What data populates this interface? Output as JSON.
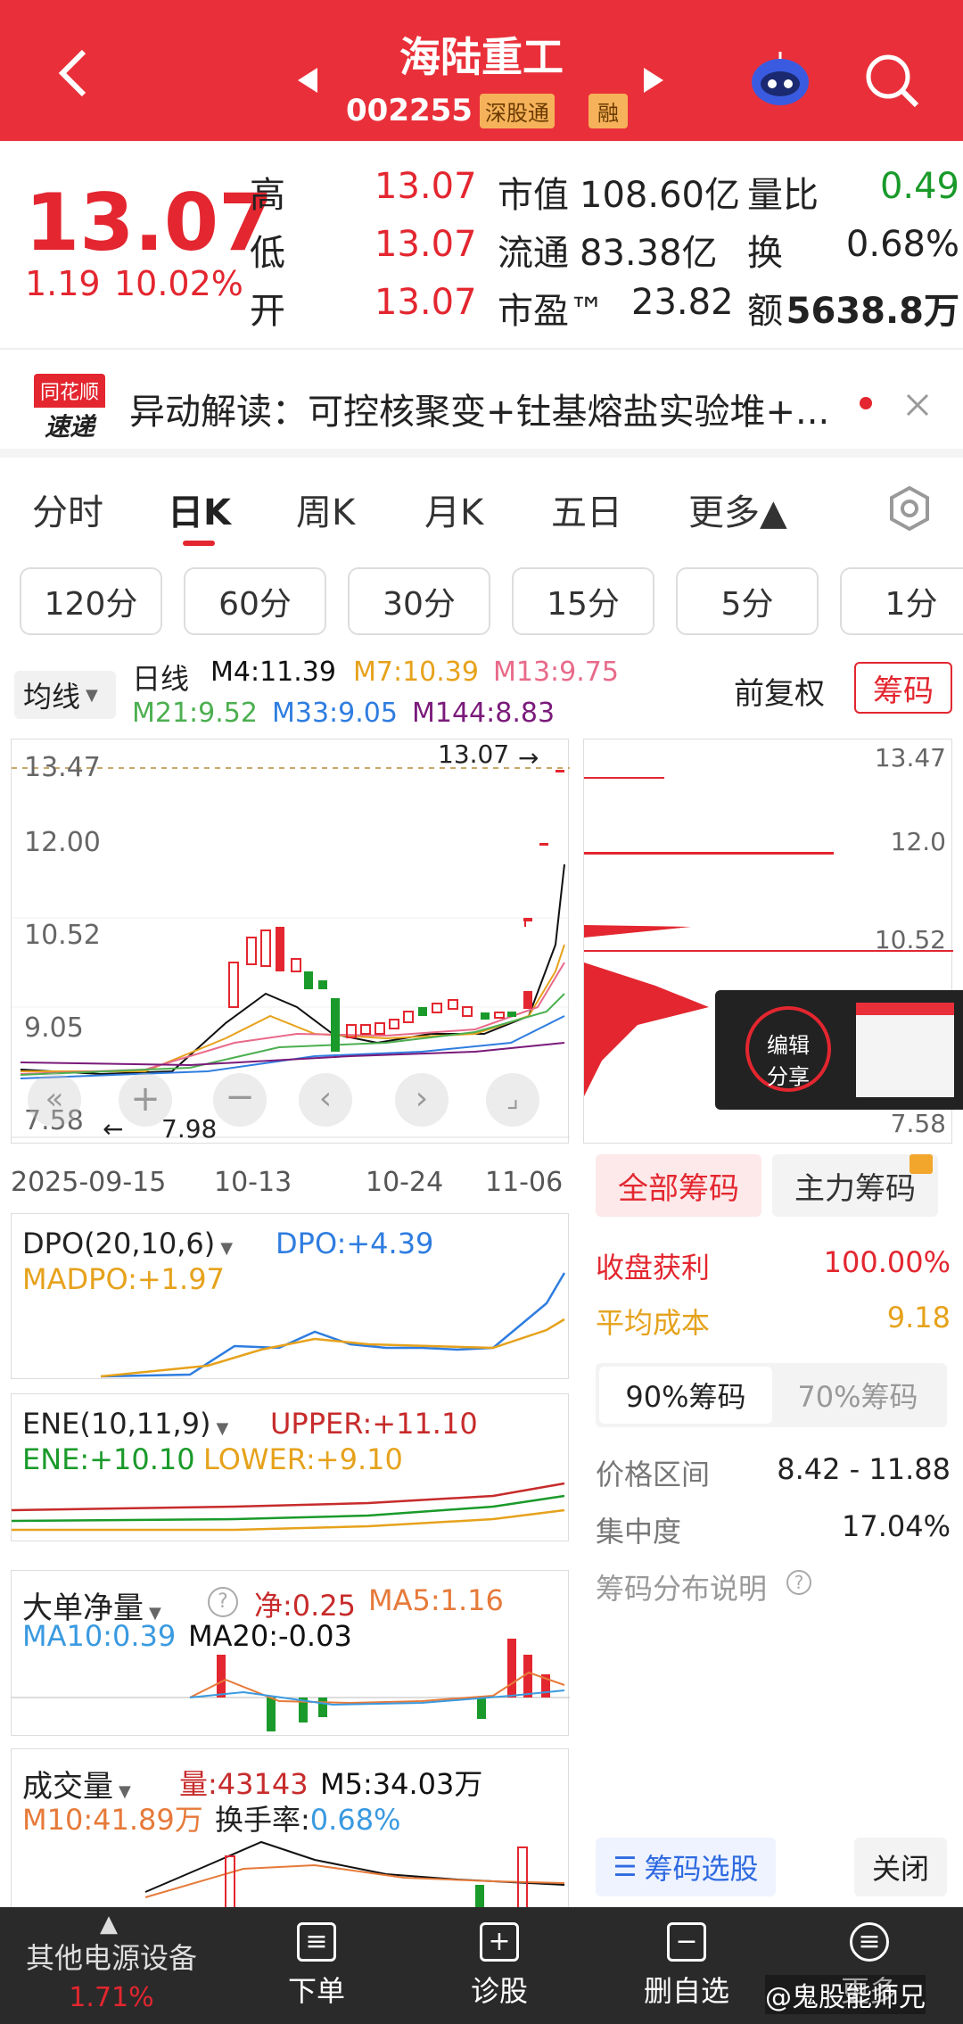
{
  "header": {
    "title": "海陆重工",
    "code": "002255",
    "badge1": "深股通",
    "badge2": "融"
  },
  "quote": {
    "price": "13.07",
    "change": "1.19",
    "pct": "10.02%",
    "high_label": "高",
    "high": "13.07",
    "low_label": "低",
    "low": "13.07",
    "open_label": "开",
    "open": "13.07",
    "mcap_label": "市值",
    "mcap": "108.60亿",
    "float_label": "流通",
    "float": "83.38亿",
    "pe_label": "市盈™",
    "pe": "23.82",
    "vr_label": "量比",
    "vr": "0.49",
    "turn_label": "换",
    "turn": "0.68%",
    "amt_label": "额",
    "amt": "5638.8万"
  },
  "news": {
    "logo1": "同花顺",
    "logo2": "速递",
    "text": "异动解读：可控核聚变+钍基熔盐实验堆+..."
  },
  "tabs": [
    "分时",
    "日K",
    "周K",
    "月K",
    "五日",
    "更多▲"
  ],
  "periods": [
    "120分",
    "60分",
    "30分",
    "15分",
    "5分",
    "1分"
  ],
  "ma": {
    "toggle": "均线",
    "line": "日线",
    "m4": "M4:11.39",
    "m7": "M7:10.39",
    "m13": "M13:9.75",
    "m21": "M21:9.52",
    "m33": "M33:9.05",
    "m144": "M144:8.83",
    "adj": "前复权",
    "chips_btn": "筹码"
  },
  "kline": {
    "yticks": [
      "13.47",
      "12.00",
      "10.52",
      "9.05",
      "7.58"
    ],
    "dates": [
      "2025-09-15",
      "10-13",
      "10-24",
      "11-06"
    ],
    "high_mark": "13.07",
    "low_mark": "7.98"
  },
  "chip_axis": [
    "13.47",
    "12.0",
    "10.52",
    "7.58"
  ],
  "share": {
    "line1": "编辑",
    "line2": "分享"
  },
  "chips": {
    "tab_all": "全部筹码",
    "tab_main": "主力筹码",
    "profit_label": "收盘获利",
    "profit": "100.00%",
    "cost_label": "平均成本",
    "cost": "9.18",
    "p90": "90%筹码",
    "p70": "70%筹码",
    "range_label": "价格区间",
    "range": "8.42 - 11.88",
    "conc_label": "集中度",
    "conc": "17.04%",
    "explain": "筹码分布说明",
    "select": "筹码选股",
    "close": "关闭"
  },
  "dpo": {
    "title": "DPO(20,10,6)",
    "dpo": "DPO:+4.39",
    "madpo": "MADPO:+1.97"
  },
  "ene": {
    "title": "ENE(10,11,9)",
    "upper": "UPPER:+11.10",
    "ene": "ENE:+10.10",
    "lower": "LOWER:+9.10"
  },
  "bigorder": {
    "title": "大单净量",
    "net": "净:0.25",
    "ma5": "MA5:1.16",
    "ma10": "MA10:0.39",
    "ma20": "MA20:-0.03"
  },
  "volume": {
    "title": "成交量",
    "vol": "量:43143",
    "m5": "M5:34.03万",
    "m10": "M10:41.89万",
    "turn_label": "换手率:",
    "turn": "0.68%"
  },
  "bottom": {
    "sector": "其他电源设备",
    "sector_pct": "1.71%",
    "order": "下单",
    "diag": "诊股",
    "del": "删自选",
    "more": "更多",
    "watermark": "@鬼股能师兄"
  },
  "colors": {
    "red": "#e3262f",
    "green": "#1a9a2a",
    "header": "#e9303a"
  }
}
